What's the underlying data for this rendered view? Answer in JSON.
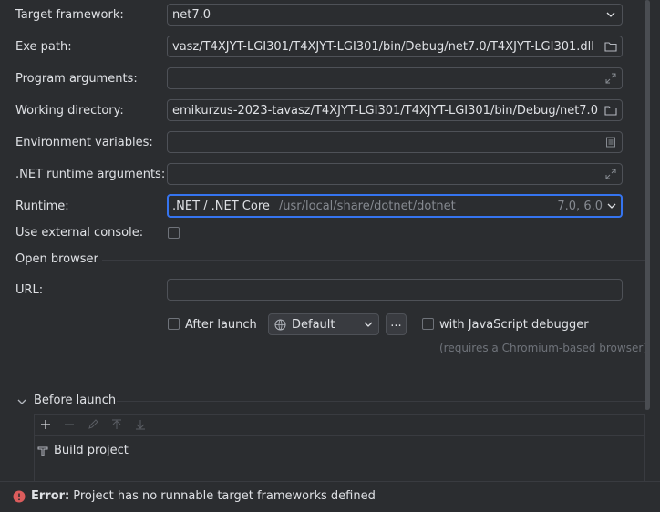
{
  "fields": {
    "target_framework": {
      "label": "Target framework:",
      "value": "net7.0"
    },
    "exe_path": {
      "label": "Exe path:",
      "value": "vasz/T4XJYT-LGI301/T4XJYT-LGI301/bin/Debug/net7.0/T4XJYT-LGI301.dll"
    },
    "program_arguments": {
      "label": "Program arguments:",
      "value": ""
    },
    "working_directory": {
      "label": "Working directory:",
      "value": "emikurzus-2023-tavasz/T4XJYT-LGI301/T4XJYT-LGI301/bin/Debug/net7.0"
    },
    "environment_variables": {
      "label": "Environment variables:",
      "value": ""
    },
    "net_runtime_arguments": {
      "label": ".NET runtime arguments:",
      "value": ""
    },
    "runtime": {
      "label": "Runtime:",
      "name": ".NET / .NET Core",
      "path": "/usr/local/share/dotnet/dotnet",
      "versions": "7.0, 6.0"
    },
    "external_console": {
      "label": "Use external console:",
      "checked": false
    }
  },
  "open_browser": {
    "title": "Open browser",
    "url_label": "URL:",
    "url_value": "",
    "after_launch_label": "After launch",
    "browser_value": "Default",
    "more_label": "...",
    "js_debugger_label": "with JavaScript debugger",
    "js_hint": "(requires a Chromium-based browser)"
  },
  "before_launch": {
    "title": "Before launch",
    "tasks": [
      "Build project"
    ]
  },
  "status": {
    "prefix": "Error:",
    "message": "Project has no runnable target frameworks defined"
  },
  "colors": {
    "background": "#2b2d30",
    "accent_focus": "#3574f0",
    "error": "#db5c5c"
  }
}
